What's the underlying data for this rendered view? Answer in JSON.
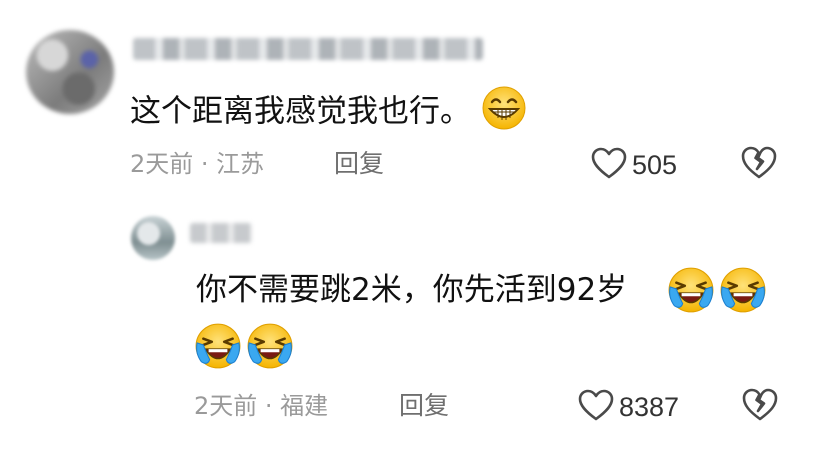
{
  "comments": [
    {
      "text": "这个距离我感觉我也行。",
      "emojis": [
        "grinning-face-icon"
      ],
      "time": "2天前",
      "location": "江苏",
      "reply_label": "回复",
      "likes": "505"
    },
    {
      "text": "你不需要跳2米，你先活到92岁",
      "emojis": [
        "rolling-laughing-icon",
        "rolling-laughing-icon",
        "rolling-laughing-icon",
        "rolling-laughing-icon"
      ],
      "time": "2天前",
      "location": "福建",
      "reply_label": "回复",
      "likes": "8387"
    }
  ],
  "separator": " · "
}
